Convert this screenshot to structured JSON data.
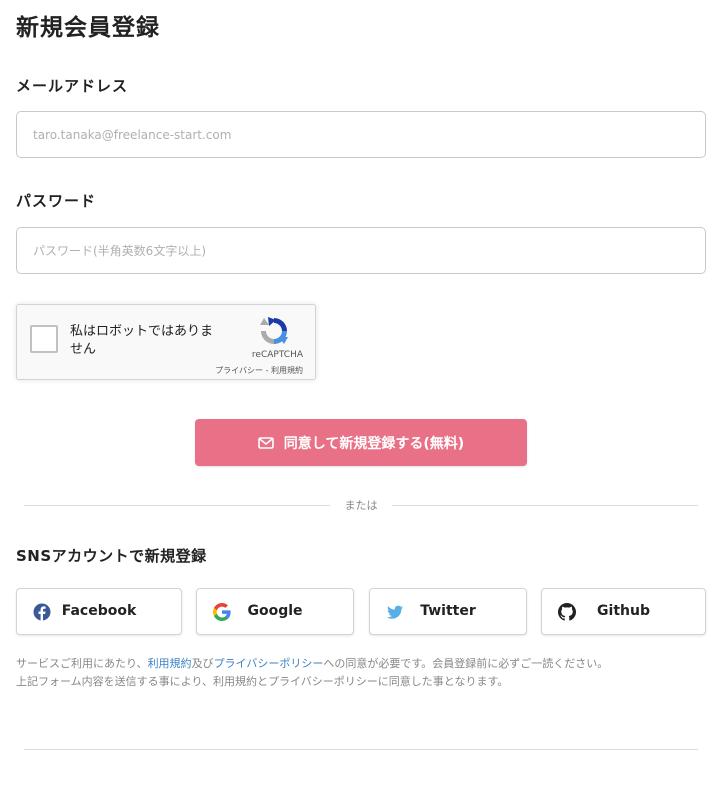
{
  "page": {
    "title": "新規会員登録"
  },
  "email": {
    "label": "メールアドレス",
    "placeholder": "taro.tanaka@freelance-start.com",
    "value": ""
  },
  "password": {
    "label": "パスワード",
    "placeholder": "パスワード(半角英数6文字以上)",
    "value": ""
  },
  "captcha": {
    "label": "私はロボットではありません",
    "brand": "reCAPTCHA",
    "terms": "プライバシー - 利用規約",
    "icon": "recaptcha-icon"
  },
  "submit": {
    "label": "同意して新規登録する(無料)",
    "icon": "mail-icon",
    "color": "#e97187"
  },
  "divider": {
    "text": "または"
  },
  "sns": {
    "title": "SNSアカウントで新規登録",
    "buttons": [
      {
        "label": "Facebook",
        "icon": "facebook-icon",
        "color": "#3b5998"
      },
      {
        "label": "Google",
        "icon": "google-icon",
        "color": "#4285f4"
      },
      {
        "label": "Twitter",
        "icon": "twitter-icon",
        "color": "#1da1f2"
      },
      {
        "label": "Github",
        "icon": "github-icon",
        "color": "#222222"
      }
    ]
  },
  "notice": {
    "line1_prefix": "サービスご利用にあたり、",
    "terms_link": "利用規約",
    "conj": "及び",
    "privacy_link": "プライバシーポリシー",
    "line1_suffix": "への同意が必要です。会員登録前に必ずご一読ください。",
    "line2": "上記フォーム内容を送信する事により、利用規約とプライバシーポリシーに同意した事となります。",
    "link_color": "#3b82c4"
  }
}
